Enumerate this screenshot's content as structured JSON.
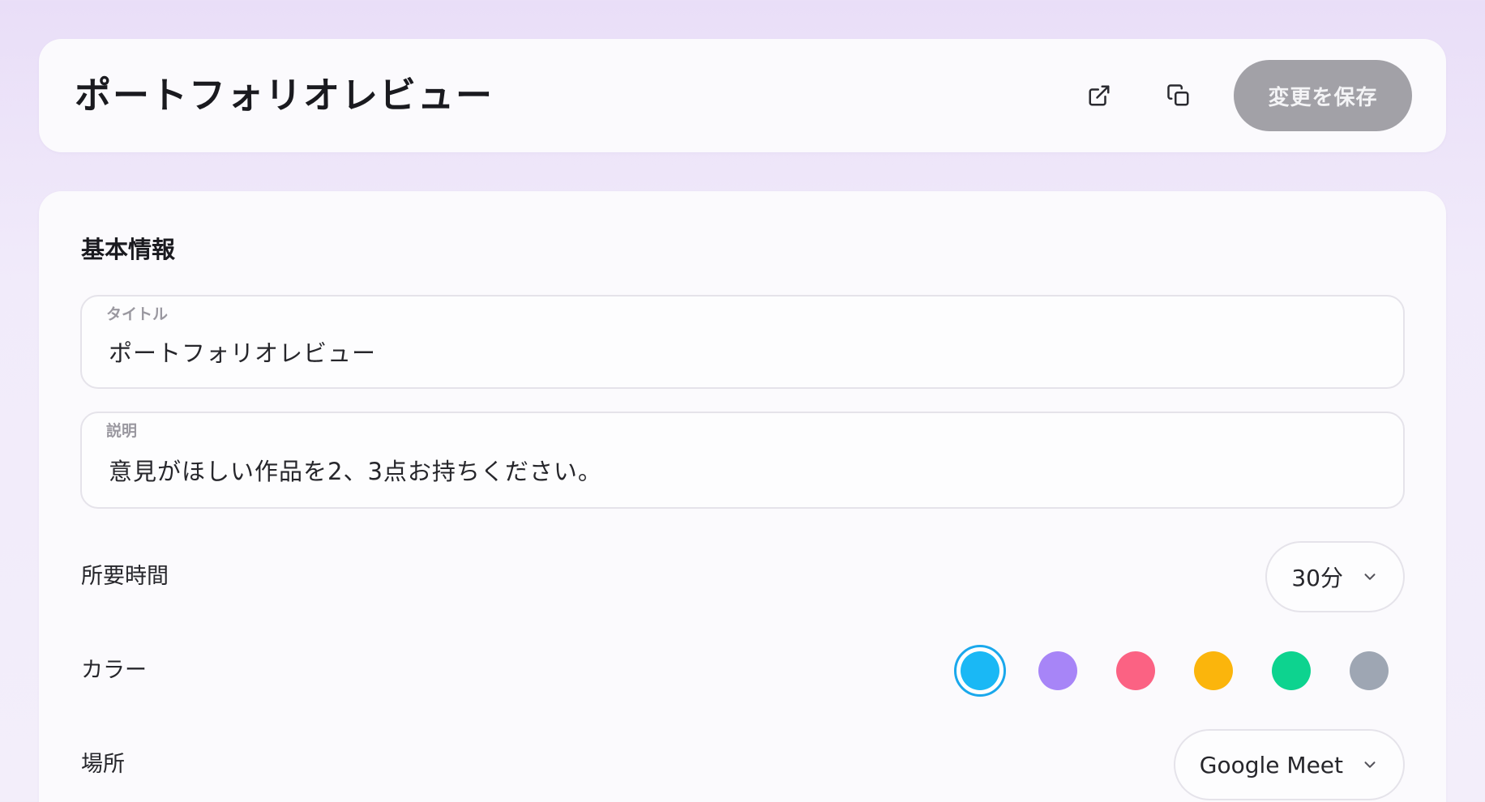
{
  "header": {
    "title": "ポートフォリオレビュー",
    "open_external_icon": "external-link-icon",
    "copy_icon": "copy-icon",
    "save_label": "変更を保存"
  },
  "basic_info": {
    "section_title": "基本情報",
    "title_field": {
      "label": "タイトル",
      "value": "ポートフォリオレビュー"
    },
    "description_field": {
      "label": "説明",
      "value": "意見がほしい作品を2、3点お持ちください。"
    },
    "duration": {
      "label": "所要時間",
      "value": "30分"
    },
    "color": {
      "label": "カラー",
      "options": [
        "#1ab8f5",
        "#a785f7",
        "#fb6283",
        "#fbb50c",
        "#0dd38f",
        "#9ea6b3"
      ],
      "selected_index": 0
    },
    "location": {
      "label": "場所",
      "value": "Google Meet"
    }
  }
}
